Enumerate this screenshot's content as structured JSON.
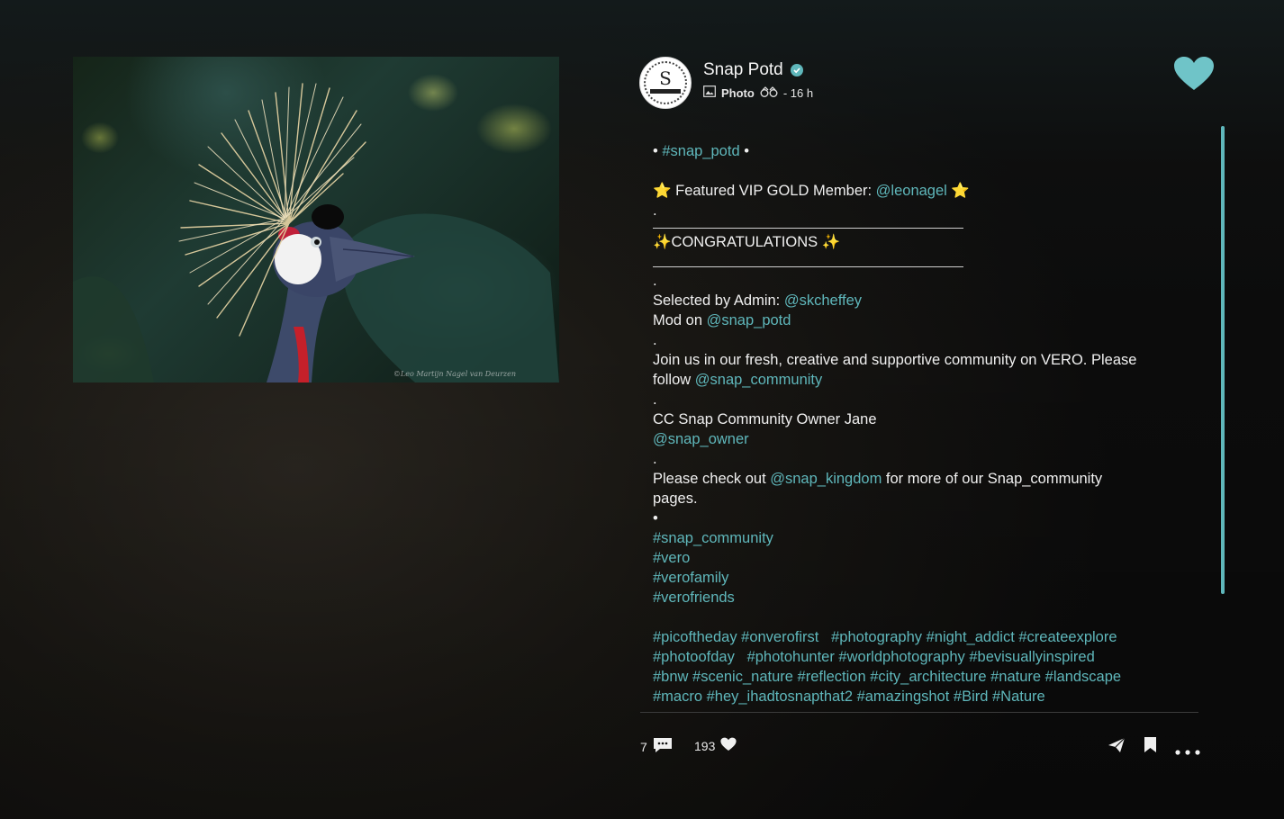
{
  "post": {
    "author": "Snap Potd",
    "post_type": "Photo",
    "time": "- 16 h",
    "photo_watermark": "©Leo Martijn Nagel van Deurzen"
  },
  "caption": {
    "l1_prefix": "• ",
    "l1_tag": "#snap_potd",
    "l1_suffix": " •",
    "l2_prefix": "⭐ Featured VIP GOLD Member: ",
    "l2_mention": "@leonagel",
    "l2_suffix": " ⭐",
    "dot": ".",
    "congrats": "✨CONGRATULATIONS ✨",
    "admin_prefix": "Selected by Admin: ",
    "admin_mention": "@skcheffey",
    "mod_prefix": "Mod on ",
    "mod_mention": "@snap_potd",
    "join_text": "Join us in our fresh, creative and supportive community on VERO. Please",
    "follow_prefix": "follow ",
    "follow_mention": "@snap_community",
    "owner_text": "CC Snap Community Owner Jane",
    "owner_mention": "@snap_owner",
    "check_prefix": "Please check out ",
    "check_mention": "@snap_kingdom",
    "check_suffix": " for more of our Snap_community",
    "pages_text": "pages.",
    "bullet": "•",
    "tag1": "#snap_community",
    "tag2": "#vero",
    "tag3": "#verofamily",
    "tag4": "#verofriends",
    "tags_line1": "#picoftheday #onverofirst   #photography #night_addict #createexplore",
    "tags_line2": "#photoofday   #photohunter #worldphotography #bevisuallyinspired",
    "tags_line3": "#bnw #scenic_nature #reflection #city_architecture #nature #landscape",
    "tags_line4": "#macro #hey_ihadtosnapthat2 #amazingshot #Bird #Nature"
  },
  "footer": {
    "comments_count": "7",
    "likes_count": "193"
  },
  "colors": {
    "accent": "#5fb7bb",
    "text": "#f0f0f0"
  },
  "icons": [
    "verified-icon",
    "photo-icon",
    "binoculars-icon",
    "heart-icon",
    "comment-icon",
    "like-icon",
    "share-icon",
    "bookmark-icon",
    "more-icon"
  ]
}
